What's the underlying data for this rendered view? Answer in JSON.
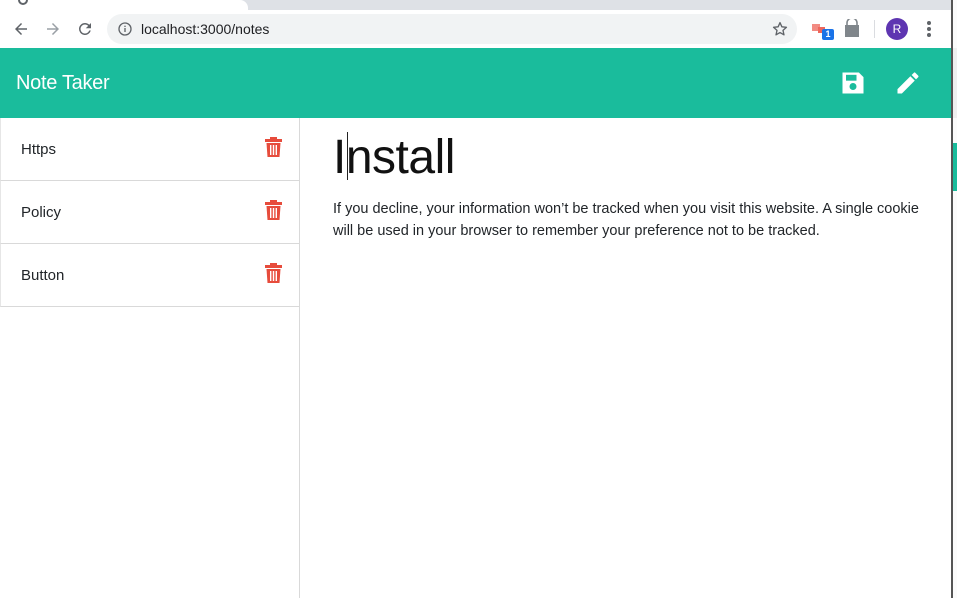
{
  "browser": {
    "url": "localhost:3000/notes",
    "profile_initial": "R",
    "extension_badge": "1",
    "icons": [
      "back-arrow-icon",
      "forward-arrow-icon",
      "reload-icon",
      "info-icon",
      "star-icon",
      "extension-icon",
      "shopping-bag-icon",
      "more-vert-icon"
    ]
  },
  "app": {
    "title": "Note Taker",
    "header_icons": [
      "save-icon",
      "pencil-icon"
    ],
    "accent_color": "#1abc9c",
    "delete_color": "#e74c3c"
  },
  "notes": [
    {
      "title": "Https"
    },
    {
      "title": "Policy"
    },
    {
      "title": "Button"
    }
  ],
  "active_note": {
    "title": "Install",
    "text": "If you decline, your information won’t be tracked when you visit this website. A single cookie will be used in your browser to remember your preference not to be tracked."
  }
}
